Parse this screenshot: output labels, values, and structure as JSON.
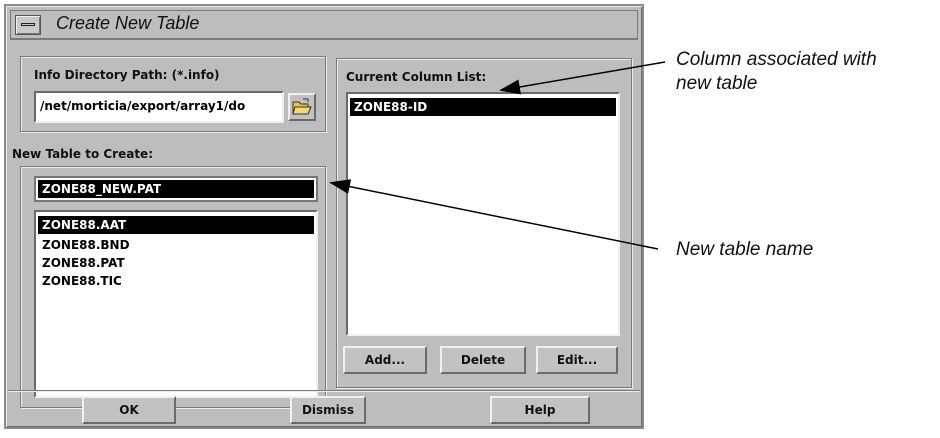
{
  "dialog": {
    "title": "Create New Table"
  },
  "info_dir": {
    "label": "Info Directory Path: (*.info)",
    "path_value": "/net/morticia/export/array1/do"
  },
  "new_table": {
    "label": "New Table to Create:",
    "name_value": "ZONE88_NEW.PAT",
    "items": [
      "ZONE88.AAT",
      "ZONE88.BND",
      "ZONE88.PAT",
      "ZONE88.TIC"
    ],
    "selected_index": 0
  },
  "columns": {
    "label": "Current Column List:",
    "items": [
      "ZONE88-ID"
    ],
    "selected_index": 0,
    "add_label": "Add...",
    "delete_label": "Delete",
    "edit_label": "Edit..."
  },
  "footer": {
    "ok_label": "OK",
    "dismiss_label": "Dismiss",
    "help_label": "Help"
  },
  "annotations": {
    "column_line1": "Column associated with",
    "column_line2": "new table",
    "table_name": "New table name"
  },
  "icons": {
    "browse": "folder-open-icon",
    "window_menu": "window-menu-icon"
  }
}
